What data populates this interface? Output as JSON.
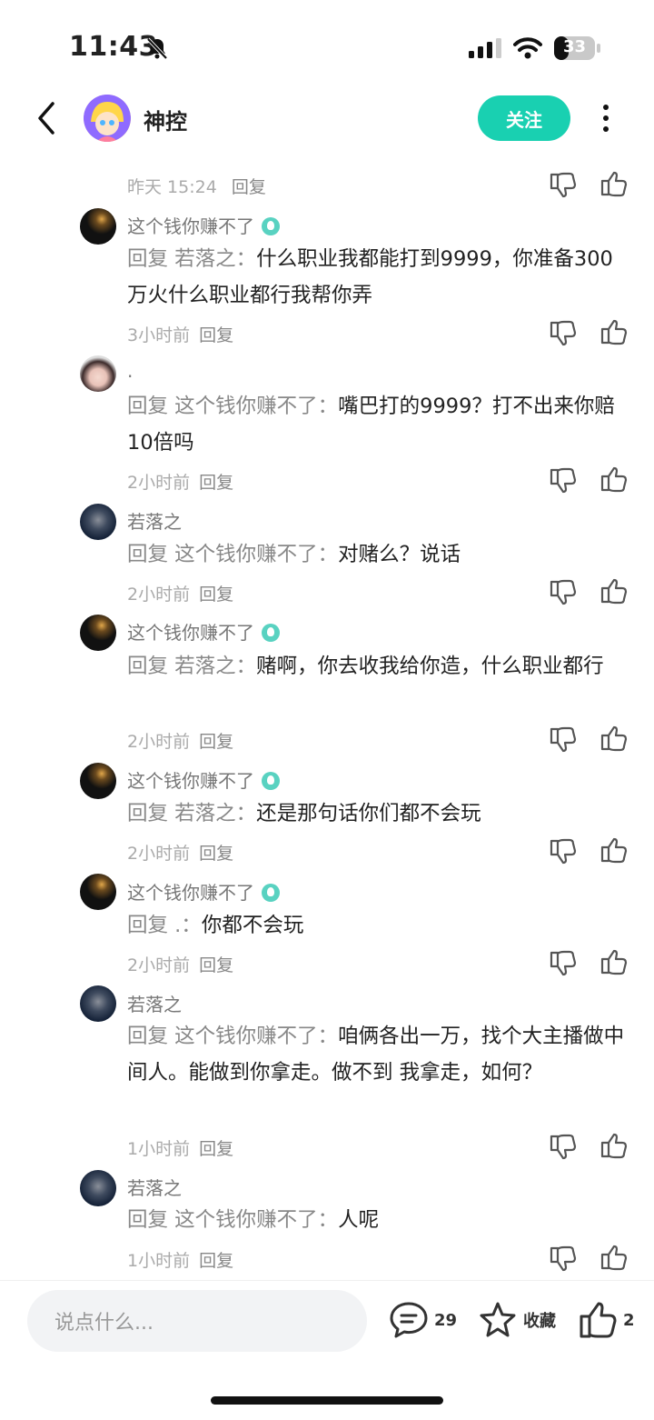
{
  "status": {
    "time": "11:43",
    "battery": "33"
  },
  "header": {
    "title": "神控",
    "follow_label": "关注"
  },
  "top_meta": {
    "time": "昨天 15:24",
    "reply": "回复"
  },
  "comments": [
    {
      "name": "这个钱你赚不了",
      "verified": true,
      "prefix": "回复 若落之：",
      "text": "什么职业我都能打到9999，你准备300万火什么职业都行我帮你弄",
      "time": "3小时前",
      "reply": "回复"
    },
    {
      "name": ".",
      "verified": false,
      "prefix": "回复 这个钱你赚不了：",
      "text": "嘴巴打的9999？打不出来你赔10倍吗",
      "time": "2小时前",
      "reply": "回复"
    },
    {
      "name": "若落之",
      "verified": false,
      "prefix": "回复 这个钱你赚不了：",
      "text": "对赌么？说话",
      "time": "2小时前",
      "reply": "回复"
    },
    {
      "name": "这个钱你赚不了",
      "verified": true,
      "prefix": "回复 若落之：",
      "text": "赌啊，你去收我给你造，什么职业都行",
      "time": "2小时前",
      "reply": "回复"
    },
    {
      "name": "这个钱你赚不了",
      "verified": true,
      "prefix": "回复 若落之：",
      "text": "还是那句话你们都不会玩",
      "time": "2小时前",
      "reply": "回复"
    },
    {
      "name": "这个钱你赚不了",
      "verified": true,
      "prefix": "回复 .：",
      "text": "你都不会玩",
      "time": "2小时前",
      "reply": "回复"
    },
    {
      "name": "若落之",
      "verified": false,
      "prefix": "回复 这个钱你赚不了：",
      "text": "咱俩各出一万，找个大主播做中间人。能做到你拿走。做不到 我拿走，如何？",
      "time": "1小时前",
      "reply": "回复"
    },
    {
      "name": "若落之",
      "verified": false,
      "prefix": "回复 这个钱你赚不了：",
      "text": "人呢",
      "time": "1小时前",
      "reply": "回复"
    }
  ],
  "bottom_bar": {
    "input_placeholder": "说点什么...",
    "comment_count": "29",
    "favorite_label": "收藏",
    "like_count": "2"
  },
  "colors": {
    "accent": "#19d0b1",
    "verified_badge": "#59d2c1"
  }
}
